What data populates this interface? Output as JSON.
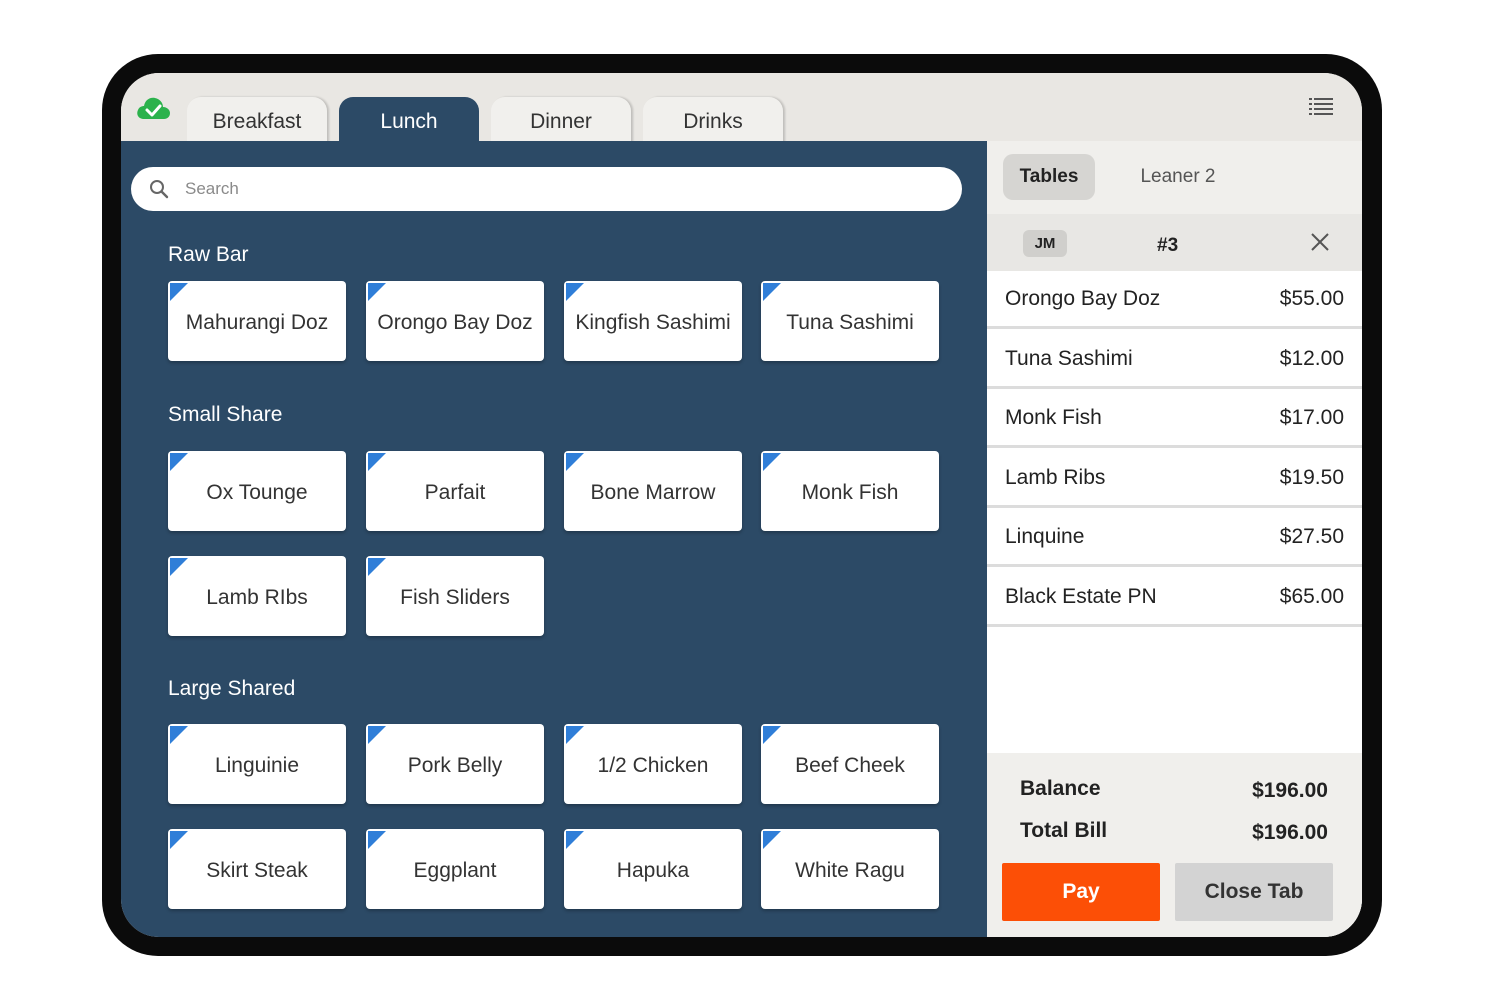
{
  "tabs": [
    {
      "label": "Breakfast",
      "active": false
    },
    {
      "label": "Lunch",
      "active": true
    },
    {
      "label": "Dinner",
      "active": false
    },
    {
      "label": "Drinks",
      "active": false
    }
  ],
  "search": {
    "placeholder": "Search",
    "value": ""
  },
  "sections": [
    {
      "title": "Raw Bar",
      "items": [
        "Mahurangi Doz",
        "Orongo Bay Doz",
        "Kingfish Sashimi",
        "Tuna Sashimi"
      ]
    },
    {
      "title": "Small Share",
      "items": [
        "Ox Tounge",
        "Parfait",
        "Bone Marrow",
        "Monk Fish",
        "Lamb RIbs",
        "Fish Sliders"
      ]
    },
    {
      "title": "Large Shared",
      "items": [
        "Linguinie",
        "Pork Belly",
        "1/2 Chicken",
        "Beef Cheek",
        "Skirt Steak",
        "Eggplant",
        "Hapuka",
        "White Ragu"
      ]
    }
  ],
  "order": {
    "tabs": {
      "tables": "Tables",
      "leaner": "Leaner 2"
    },
    "server_initials": "JM",
    "table_number": "#3",
    "items": [
      {
        "name": "Orongo Bay Doz",
        "price": "$55.00"
      },
      {
        "name": "Tuna Sashimi",
        "price": "$12.00"
      },
      {
        "name": "Monk Fish",
        "price": "$17.00"
      },
      {
        "name": "Lamb Ribs",
        "price": "$19.50"
      },
      {
        "name": "Linquine",
        "price": "$27.50"
      },
      {
        "name": "Black Estate PN",
        "price": "$65.00"
      }
    ],
    "balance_label": "Balance",
    "balance": "$196.00",
    "total_label": "Total Bill",
    "total": "$196.00",
    "pay_label": "Pay",
    "close_tab_label": "Close Tab"
  },
  "colors": {
    "panel": "#2c4a66",
    "item_corner": "#2f7ed8",
    "pay": "#fc4f06",
    "cloud": "#2bb24c"
  },
  "icons": [
    "cloud-check-icon",
    "list-menu-icon",
    "search-icon",
    "close-icon"
  ]
}
